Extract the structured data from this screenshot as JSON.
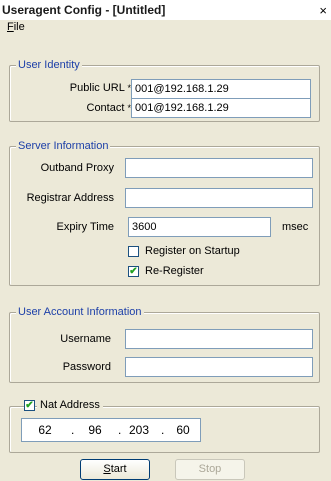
{
  "window": {
    "title": "Useragent Config - [Untitled]",
    "close_glyph": "×"
  },
  "menu": {
    "file_label": "File"
  },
  "user_identity": {
    "legend": "User Identity",
    "public_url_label": "Public URL",
    "public_url_value": "001@192.168.1.29",
    "contact_label": "Contact",
    "contact_value": "001@192.168.1.29",
    "required_mark": "*"
  },
  "server_info": {
    "legend": "Server Information",
    "outbound_proxy_label": "Outband Proxy",
    "outbound_proxy_value": "",
    "registrar_label": "Registrar Address",
    "registrar_value": "",
    "expiry_label": "Expiry Time",
    "expiry_value": "3600",
    "expiry_unit": "msec",
    "register_on_startup_label": "Register on Startup",
    "register_on_startup_checked": false,
    "re_register_label": "Re-Register",
    "re_register_checked": true
  },
  "user_account": {
    "legend": "User Account Information",
    "username_label": "Username",
    "username_value": "",
    "password_label": "Password",
    "password_value": ""
  },
  "nat": {
    "checkbox_label": "Nat Address",
    "checked": true,
    "octets": [
      "62",
      "96",
      "203",
      "60"
    ]
  },
  "buttons": {
    "start_label": "Start",
    "stop_label": "Stop",
    "stop_enabled": false
  },
  "colors": {
    "legend": "#1c3fa8",
    "check": "#21a121",
    "dialog_bg": "#ece9d8",
    "field_border": "#7f9db9"
  },
  "check_glyph": "✔"
}
